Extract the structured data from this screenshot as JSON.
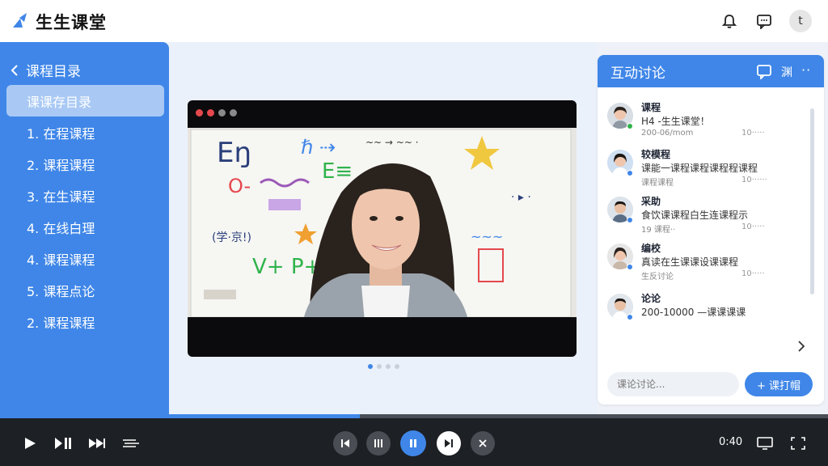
{
  "app": {
    "title": "生生课堂",
    "avatar_letter": "t"
  },
  "sidebar": {
    "header": "课程目录",
    "items": [
      {
        "label": "课课存目录",
        "active": true
      },
      {
        "label": "1. 在程课程"
      },
      {
        "label": "2. 课程课程"
      },
      {
        "label": "3. 在生课程"
      },
      {
        "label": "4. 在线白理"
      },
      {
        "label": "4. 课程课程"
      },
      {
        "label": "5. 课程点论"
      },
      {
        "label": "2. 课程课程"
      }
    ]
  },
  "discussion": {
    "title": "互动讨论",
    "header_label": "渊",
    "messages": [
      {
        "name": "课程",
        "text": "H4 -生生课堂！",
        "meta": "200-06/mom",
        "time": "10·····",
        "status_color": "#2fb34a"
      },
      {
        "name": "较模程",
        "text": "课能一课程课程课程程课程",
        "meta": "课程课程",
        "time": "10······",
        "status_color": "#3f86e8"
      },
      {
        "name": "采助",
        "text": "食饮课课程白生连课程示",
        "meta": "19 课程··",
        "time": "10·····",
        "status_color": "#3f86e8"
      },
      {
        "name": "编校",
        "text": "真读在生课课设课课程",
        "meta": "生反讨论",
        "time": "10·····",
        "status_color": "#3f86e8"
      },
      {
        "name": "论论",
        "text": "200-10000 —课课课课",
        "meta": "",
        "time": "",
        "status_color": "#3f86e8"
      }
    ],
    "input_placeholder": "课论讨论...",
    "send_label": "+ 课打帽"
  },
  "player": {
    "progress": 0.435,
    "time_readout": "0:40",
    "carousel_count": 4,
    "carousel_active": 0
  },
  "colors": {
    "accent": "#3f86e8",
    "sidebar": "#3f86e8",
    "controlbar": "#1d2024"
  }
}
